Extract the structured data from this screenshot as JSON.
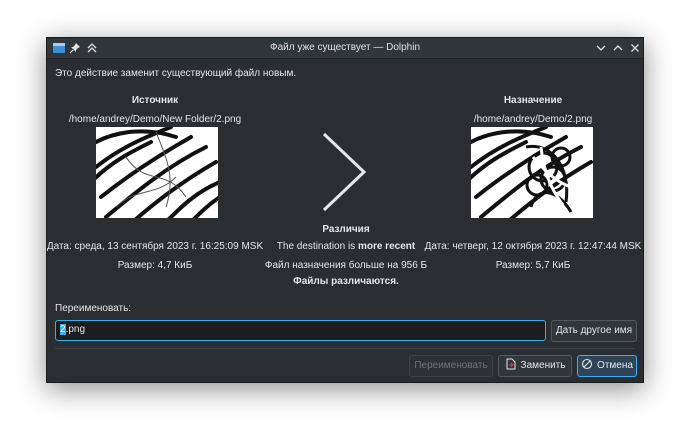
{
  "window": {
    "title": "Файл уже существует — Dolphin",
    "icons": [
      "app-icon",
      "pin-icon",
      "keep-above-icon",
      "minimize-icon",
      "maximize-icon",
      "close-icon"
    ]
  },
  "message": "Это действие заменит существующий файл новым.",
  "source": {
    "heading": "Источник",
    "path": "/home/andrey/Demo/New Folder/2.png",
    "date": "Дата: среда, 13 сентября 2023 г. 16:25:09 MSK",
    "size": "Размер: 4,7 КиБ"
  },
  "destination": {
    "heading": "Назначение",
    "path": "/home/andrey/Demo/2.png",
    "date": "Дата: четверг, 12 октября 2023 г. 12:47:44 MSK",
    "size": "Размер: 5,7 КиБ"
  },
  "differences": {
    "heading": "Различия",
    "recent_prefix": "The destination is ",
    "recent_bold": "more recent",
    "size_note": "Файл назначения больше на 956 Б",
    "conclusion": "Файлы различаются."
  },
  "rename": {
    "label": "Переименовать:",
    "value_selected": "2",
    "value_rest": ".png",
    "suggest_button": "Дать другое имя"
  },
  "buttons": {
    "rename": "Переименовать",
    "replace": "Заменить",
    "cancel": "Отмена"
  },
  "colors": {
    "accent": "#3daee9",
    "window_bg": "#2a2e32"
  }
}
